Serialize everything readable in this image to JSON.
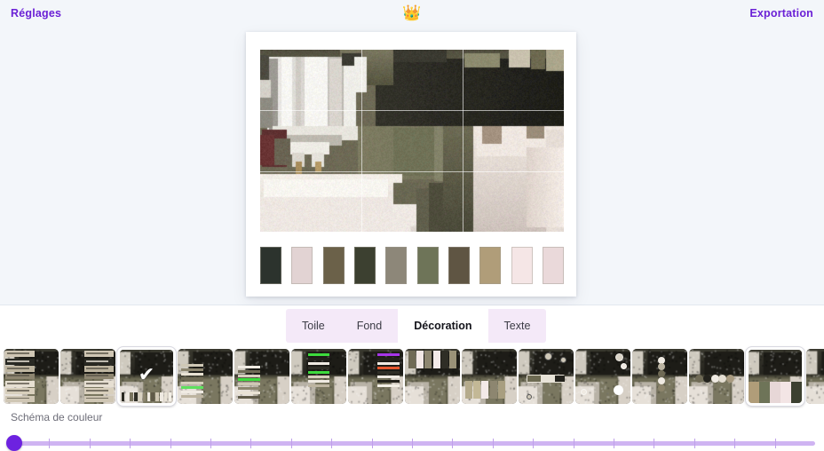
{
  "app": {
    "bg": "#f3f6fa",
    "accent": "#6b21d6"
  },
  "topbar": {
    "settings_label": "Réglages",
    "export_label": "Exportation",
    "crown_icon": "👑"
  },
  "canvas": {
    "image_alt": "espresso-machine-photo",
    "grid_overlay": true,
    "palette": [
      "#2c332d",
      "#e2d3d3",
      "#6b6149",
      "#3c4030",
      "#8d8779",
      "#6e7458",
      "#5f5543",
      "#b09d79",
      "#f5e6e6",
      "#ead9da"
    ]
  },
  "tabs": {
    "items": [
      {
        "label": "Toile",
        "active": false
      },
      {
        "label": "Fond",
        "active": false
      },
      {
        "label": "Décoration",
        "active": true
      },
      {
        "label": "Texte",
        "active": false
      }
    ]
  },
  "thumbnails": {
    "count": 15,
    "selected_index": 2,
    "items": [
      {
        "name": "thumb-swatch-list-left",
        "variant": "labels-left",
        "selected": false
      },
      {
        "name": "thumb-swatch-list-right",
        "variant": "labels-right",
        "selected": false
      },
      {
        "name": "thumb-bars-bottom",
        "variant": "bars-bottom",
        "selected": true
      },
      {
        "name": "thumb-bars-left",
        "variant": "bars-left-green",
        "selected": false
      },
      {
        "name": "thumb-bars-left-green",
        "variant": "bars-left-green2",
        "selected": false
      },
      {
        "name": "thumb-bars-center-green",
        "variant": "bars-center",
        "selected": false
      },
      {
        "name": "thumb-bars-right-purple",
        "variant": "bars-right",
        "selected": false
      },
      {
        "name": "thumb-blocks-top",
        "variant": "blocks-top",
        "selected": false
      },
      {
        "name": "thumb-blocks-top-wide",
        "variant": "blocks-top-wide",
        "selected": false
      },
      {
        "name": "thumb-blocks-bottom",
        "variant": "blocks-bottom",
        "selected": false
      },
      {
        "name": "thumb-capsule-bar",
        "variant": "capsule",
        "selected": false
      },
      {
        "name": "thumb-dots-scatter",
        "variant": "dots-scatter",
        "selected": false
      },
      {
        "name": "thumb-dots-vertical",
        "variant": "dots-vertical",
        "selected": false
      },
      {
        "name": "thumb-dots-row",
        "variant": "dots-row",
        "selected": false
      },
      {
        "name": "thumb-palette-strip",
        "variant": "palette-strip",
        "selected": false
      },
      {
        "name": "thumb-pills-vertical",
        "variant": "pills",
        "selected": false
      },
      {
        "name": "thumb-pills-edge",
        "variant": "pills-edge",
        "selected": false
      }
    ]
  },
  "slider": {
    "label": "Schéma de couleur",
    "value": 0,
    "min": 0,
    "max": 100,
    "tick_count": 19
  }
}
